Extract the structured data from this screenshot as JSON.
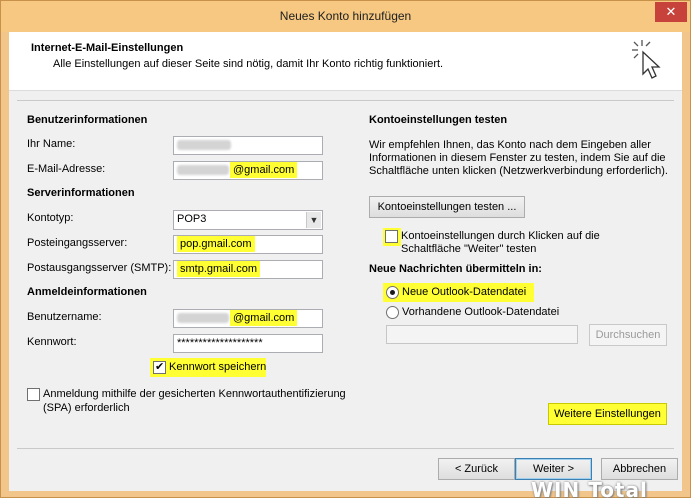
{
  "window": {
    "title": "Neues Konto hinzufügen",
    "close_glyph": "✕"
  },
  "header": {
    "title": "Internet-E-Mail-Einstellungen",
    "subtitle": "Alle Einstellungen auf dieser Seite sind nötig, damit Ihr Konto richtig funktioniert.",
    "icon": "cursor-click-icon"
  },
  "user_info": {
    "heading": "Benutzerinformationen",
    "name_label": "Ihr Name:",
    "email_label": "E-Mail-Adresse:",
    "email_suffix": "@gmail.com"
  },
  "server_info": {
    "heading": "Serverinformationen",
    "account_type_label": "Kontotyp:",
    "account_type_value": "POP3",
    "incoming_label": "Posteingangsserver:",
    "incoming_value": "pop.gmail.com",
    "outgoing_label": "Postausgangsserver (SMTP):",
    "outgoing_value": "smtp.gmail.com"
  },
  "login_info": {
    "heading": "Anmeldeinformationen",
    "username_label": "Benutzername:",
    "username_suffix": "@gmail.com",
    "password_label": "Kennwort:",
    "password_value": "********************",
    "remember_label": "Kennwort speichern",
    "spa_label_line1": "Anmeldung mithilfe der gesicherten Kennwortauthentifizierung",
    "spa_label_line2": "(SPA) erforderlich"
  },
  "test_settings": {
    "heading": "Kontoeinstellungen testen",
    "description_line1": "Wir empfehlen Ihnen, das Konto nach dem Eingeben aller",
    "description_line2": "Informationen in diesem Fenster zu testen, indem Sie auf die",
    "description_line3": "Schaltfläche unten klicken (Netzwerkverbindung erforderlich).",
    "test_button": "Kontoeinstellungen testen ...",
    "auto_test_line1": "Kontoeinstellungen durch Klicken auf die",
    "auto_test_line2": "Schaltfläche \"Weiter\" testen"
  },
  "deliver": {
    "heading": "Neue Nachrichten übermitteln in:",
    "option_new": "Neue Outlook-Datendatei",
    "option_existing": "Vorhandene Outlook-Datendatei",
    "browse_button": "Durchsuchen"
  },
  "more_settings_button": "Weitere Einstellungen",
  "watermark": "WIN Total",
  "footer": {
    "back_button": "< Zurück",
    "next_button": "Weiter >",
    "cancel_button": "Abbrechen"
  },
  "colors": {
    "highlight": "#ffff33",
    "title_bar": "#f6c882",
    "close": "#c7423a"
  }
}
